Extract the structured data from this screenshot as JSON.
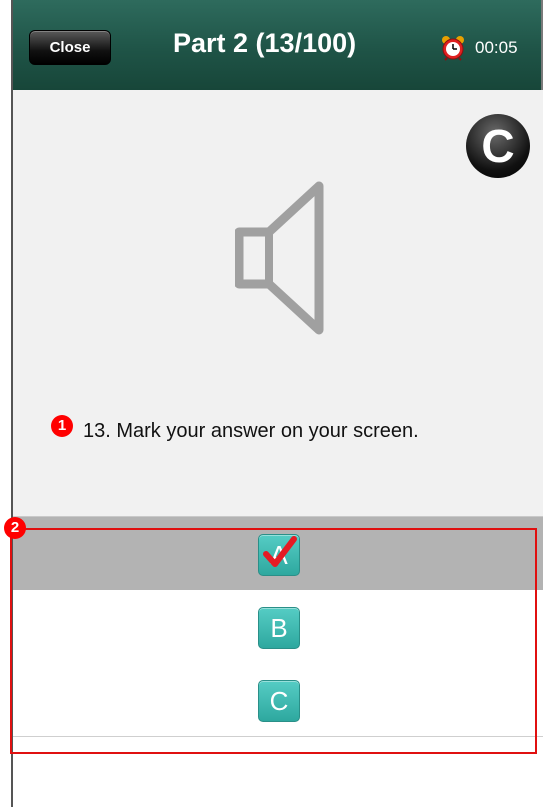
{
  "header": {
    "close_label": "Close",
    "title": "Part 2 (13/100)",
    "timer": "00:05"
  },
  "content": {
    "badge_letter": "C",
    "question_number_marker": "1",
    "question_text": "13. Mark your answer on your screen."
  },
  "options": {
    "marker": "2",
    "items": [
      {
        "label": "A",
        "selected": true
      },
      {
        "label": "B",
        "selected": false
      },
      {
        "label": "C",
        "selected": false
      }
    ]
  },
  "colors": {
    "header_bg": "#1f5447",
    "option_button": "#3bb8ae",
    "selected_row": "#b3b3b3",
    "annotation_red": "#ff0000"
  }
}
